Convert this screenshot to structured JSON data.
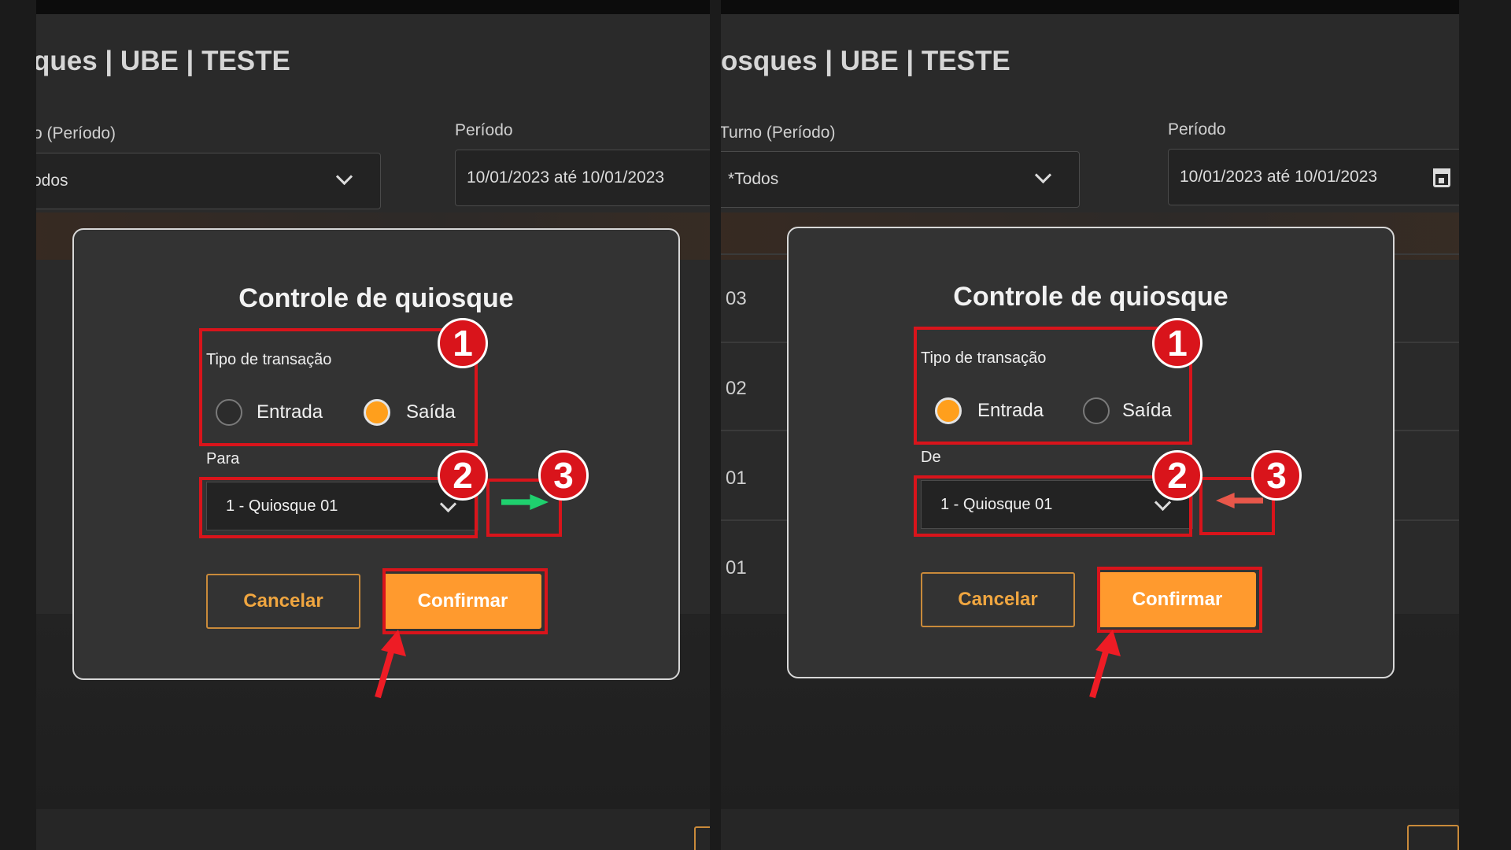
{
  "left": {
    "header": {
      "title": "ques   |   UBE | TESTE"
    },
    "filters": {
      "turno_label": "o (Período)",
      "turno_value": "odos",
      "periodo_label": "Período",
      "periodo_value": "10/01/2023 até 10/01/2023"
    },
    "rows": [],
    "modal": {
      "title": "Controle de quiosque",
      "transaction_label": "Tipo de transação",
      "option_entrada": "Entrada",
      "option_saida": "Saída",
      "selected": "Saída",
      "kiosk_label": "Para",
      "kiosk_value": "1 - Quiosque 01",
      "direction_icon": "arrow-right-icon",
      "direction_color": "#1fd06e",
      "cancel_label": "Cancelar",
      "confirm_label": "Confirmar"
    },
    "badges": [
      "1",
      "2",
      "3"
    ]
  },
  "right": {
    "header": {
      "title": "osques   |   UBE | TESTE"
    },
    "filters": {
      "turno_label": "Turno (Período)",
      "turno_value": "*Todos",
      "periodo_label": "Período",
      "periodo_value": "10/01/2023 até 10/01/2023"
    },
    "rows": [
      "03",
      "02",
      "01",
      "01"
    ],
    "modal": {
      "title": "Controle de quiosque",
      "transaction_label": "Tipo de transação",
      "option_entrada": "Entrada",
      "option_saida": "Saída",
      "selected": "Entrada",
      "kiosk_label": "De",
      "kiosk_value": "1 - Quiosque 01",
      "direction_icon": "arrow-left-icon",
      "direction_color": "#e8574a",
      "cancel_label": "Cancelar",
      "confirm_label": "Confirmar"
    },
    "badges": [
      "1",
      "2",
      "3"
    ]
  },
  "colors": {
    "accent": "#ff9a2e",
    "highlight": "#d9141b",
    "modal_bg": "#333333"
  }
}
